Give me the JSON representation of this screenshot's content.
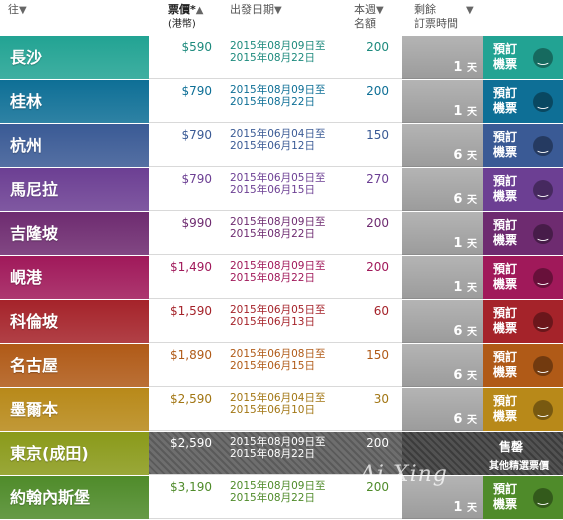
{
  "header": {
    "dest": "往",
    "price": "票價*",
    "price_sub": "(港幣)",
    "date": "出發日期",
    "seats_line1": "本週",
    "seats_line2": "名額",
    "remain_line1": "剩餘",
    "remain_line2": "訂票時間",
    "sort_down": "▼",
    "sort_up": "▲"
  },
  "rows": [
    {
      "dest": "長沙",
      "price": "$590",
      "d1": "2015年08月09日至",
      "d2": "2015年08月22日",
      "seats": "200",
      "days": "1",
      "unit": "天",
      "color": "#22a393",
      "text": "#1d8a7d"
    },
    {
      "dest": "桂林",
      "price": "$790",
      "d1": "2015年08月09日至",
      "d2": "2015年08月22日",
      "seats": "200",
      "days": "1",
      "unit": "天",
      "color": "#0e6f96",
      "text": "#0e6f96"
    },
    {
      "dest": "杭州",
      "price": "$790",
      "d1": "2015年06月04日至",
      "d2": "2015年06月12日",
      "seats": "150",
      "days": "6",
      "unit": "天",
      "color": "#3a5a95",
      "text": "#3a5a95"
    },
    {
      "dest": "馬尼拉",
      "price": "$790",
      "d1": "2015年06月05日至",
      "d2": "2015年06月15日",
      "seats": "270",
      "days": "6",
      "unit": "天",
      "color": "#6c3f93",
      "text": "#6c3f93"
    },
    {
      "dest": "吉隆坡",
      "price": "$990",
      "d1": "2015年08月09日至",
      "d2": "2015年08月22日",
      "seats": "200",
      "days": "1",
      "unit": "天",
      "color": "#6e2b70",
      "text": "#6e2b70"
    },
    {
      "dest": "峴港",
      "price": "$1,490",
      "d1": "2015年08月09日至",
      "d2": "2015年08月22日",
      "seats": "200",
      "days": "1",
      "unit": "天",
      "color": "#a0195a",
      "text": "#a0195a"
    },
    {
      "dest": "科倫坡",
      "price": "$1,590",
      "d1": "2015年06月05日至",
      "d2": "2015年06月13日",
      "seats": "60",
      "days": "6",
      "unit": "天",
      "color": "#a5232a",
      "text": "#a5232a"
    },
    {
      "dest": "名古屋",
      "price": "$1,890",
      "d1": "2015年06月08日至",
      "d2": "2015年06月15日",
      "seats": "150",
      "days": "6",
      "unit": "天",
      "color": "#b05a17",
      "text": "#b05a17"
    },
    {
      "dest": "墨爾本",
      "price": "$2,590",
      "d1": "2015年06月04日至",
      "d2": "2015年06月10日",
      "seats": "30",
      "days": "6",
      "unit": "天",
      "color": "#b88919",
      "text": "#a27613"
    },
    {
      "dest": "東京(成田)",
      "price": "$2,590",
      "d1": "2015年08月09日至",
      "d2": "2015年08月22日",
      "seats": "200",
      "color": "#8a9a1a",
      "text": "#ffffff",
      "sold": true,
      "sold_label": "售罄",
      "sold_sub": "其他精選票價"
    },
    {
      "dest": "約翰內斯堡",
      "price": "$3,190",
      "d1": "2015年08月09日至",
      "d2": "2015年08月22日",
      "seats": "200",
      "days": "1",
      "unit": "天",
      "color": "#4f8b2a",
      "text": "#4f8b2a"
    }
  ],
  "book_label": "預訂機票",
  "smile_glyph": "‿",
  "watermark": "Ai Xing"
}
